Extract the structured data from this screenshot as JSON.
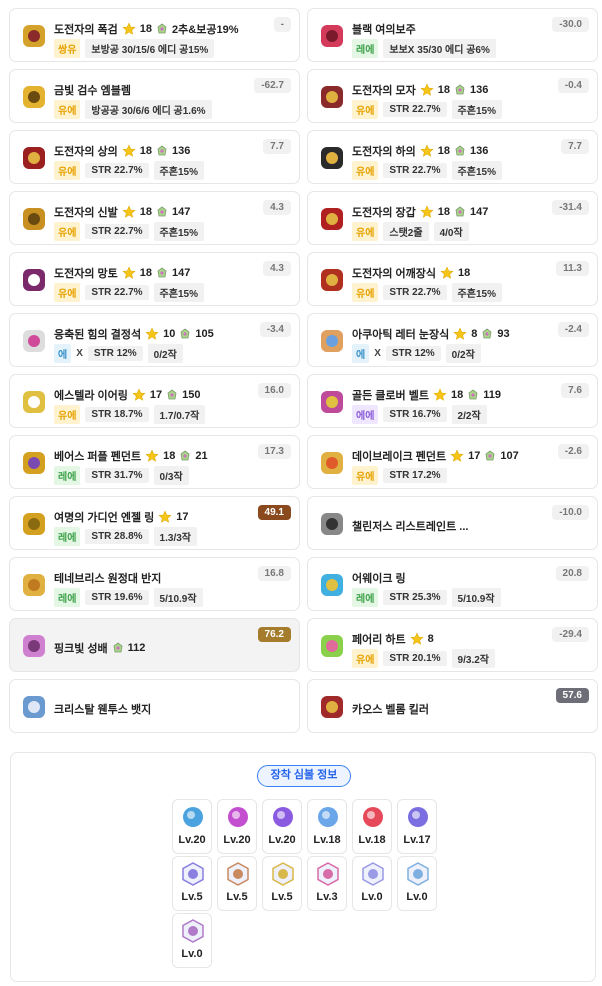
{
  "items": [
    {
      "name": "도전자의 폭검",
      "star": "18",
      "gem": "2추&보공19%",
      "tag": "쌍유",
      "tag_class": "pot-unique",
      "stats": [
        "보방공 30/15/6 에디 공15%"
      ],
      "score": "-",
      "icon": "sword-icon"
    },
    {
      "name": "블랙 여의보주",
      "star": "",
      "gem": "",
      "tag": "레에",
      "tag_class": "pot-legend",
      "stats": [
        "보보X 35/30 에디 공6%"
      ],
      "score": "-30.0",
      "icon": "orb-icon"
    },
    {
      "name": "금빛 검수 엠블렘",
      "star": "",
      "gem": "",
      "tag": "유에",
      "tag_class": "pot-unique",
      "stats": [
        "방공공 30/6/6 에디 공1.6%"
      ],
      "score": "-62.7",
      "icon": "emblem-icon"
    },
    {
      "name": "도전자의 모자",
      "star": "18",
      "gem": "136",
      "tag": "유에",
      "tag_class": "pot-unique",
      "stats": [
        "STR 22.7%",
        "주흔15%"
      ],
      "score": "-0.4",
      "icon": "hat-icon"
    },
    {
      "name": "도전자의 상의",
      "star": "18",
      "gem": "136",
      "tag": "유에",
      "tag_class": "pot-unique",
      "stats": [
        "STR 22.7%",
        "주흔15%"
      ],
      "score": "7.7",
      "icon": "top-icon"
    },
    {
      "name": "도전자의 하의",
      "star": "18",
      "gem": "136",
      "tag": "유에",
      "tag_class": "pot-unique",
      "stats": [
        "STR 22.7%",
        "주흔15%"
      ],
      "score": "7.7",
      "icon": "pants-icon"
    },
    {
      "name": "도전자의 신발",
      "star": "18",
      "gem": "147",
      "tag": "유에",
      "tag_class": "pot-unique",
      "stats": [
        "STR 22.7%",
        "주흔15%"
      ],
      "score": "4.3",
      "icon": "shoes-icon"
    },
    {
      "name": "도전자의 장갑",
      "star": "18",
      "gem": "147",
      "tag": "유에",
      "tag_class": "pot-unique",
      "stats": [
        "스탯2줄",
        "4/0작"
      ],
      "score": "-31.4",
      "icon": "glove-icon"
    },
    {
      "name": "도전자의 망토",
      "star": "18",
      "gem": "147",
      "tag": "유에",
      "tag_class": "pot-unique",
      "stats": [
        "STR 22.7%",
        "주흔15%"
      ],
      "score": "4.3",
      "icon": "cape-icon"
    },
    {
      "name": "도전자의 어깨장식",
      "star": "18",
      "gem": "",
      "tag": "유에",
      "tag_class": "pot-unique",
      "stats": [
        "STR 22.7%",
        "주흔15%"
      ],
      "score": "11.3",
      "icon": "shoulder-icon"
    },
    {
      "name": "응축된 힘의 결정석",
      "star": "10",
      "gem": "105",
      "tag": "에",
      "tag_class": "pot-rare",
      "tag2": "X",
      "stats": [
        "STR 12%",
        "0/2작"
      ],
      "score": "-3.4",
      "icon": "pocket-icon"
    },
    {
      "name": "아쿠아틱 레터 눈장식",
      "star": "8",
      "gem": "93",
      "tag": "에",
      "tag_class": "pot-rare",
      "tag2": "X",
      "stats": [
        "STR 12%",
        "0/2작"
      ],
      "score": "-2.4",
      "icon": "eye-icon"
    },
    {
      "name": "에스텔라 이어링",
      "star": "17",
      "gem": "150",
      "tag": "유에",
      "tag_class": "pot-unique",
      "stats": [
        "STR 18.7%",
        "1.7/0.7작"
      ],
      "score": "16.0",
      "icon": "earring-icon"
    },
    {
      "name": "골든 클로버 벨트",
      "star": "18",
      "gem": "119",
      "tag": "에에",
      "tag_class": "pot-epic",
      "stats": [
        "STR 16.7%",
        "2/2작"
      ],
      "score": "7.6",
      "icon": "belt-icon"
    },
    {
      "name": "베어스 퍼플 펜던트",
      "star": "18",
      "gem": "21",
      "tag": "레에",
      "tag_class": "pot-legend",
      "stats": [
        "STR 31.7%",
        "0/3작"
      ],
      "score": "17.3",
      "icon": "pendant-icon"
    },
    {
      "name": "데이브레이크 펜던트",
      "star": "17",
      "gem": "107",
      "tag": "유에",
      "tag_class": "pot-unique",
      "stats": [
        "STR 17.2%"
      ],
      "score": "-2.6",
      "icon": "pendant2-icon"
    },
    {
      "name": "여명의 가디언 엔젤 링",
      "star": "17",
      "gem": "",
      "tag": "레에",
      "tag_class": "pot-legend",
      "stats": [
        "STR 28.8%",
        "1.3/3작"
      ],
      "score": "49.1",
      "icon": "ring-icon",
      "score_class": "dark"
    },
    {
      "name": "챌린저스 리스트레인트 ...",
      "star": "",
      "gem": "",
      "tag": "",
      "tag_class": "",
      "stats": [],
      "score": "-10.0",
      "icon": "ring2-icon"
    },
    {
      "name": "테네브리스 원정대 반지",
      "star": "",
      "gem": "",
      "tag": "레에",
      "tag_class": "pot-legend",
      "stats": [
        "STR 19.6%",
        "5/10.9작"
      ],
      "score": "16.8",
      "icon": "ring3-icon"
    },
    {
      "name": "어웨이크 링",
      "star": "",
      "gem": "",
      "tag": "레에",
      "tag_class": "pot-legend",
      "stats": [
        "STR 25.3%",
        "5/10.9작"
      ],
      "score": "20.8",
      "icon": "ring4-icon"
    },
    {
      "name": "핑크빛 성배",
      "star": "",
      "gem": "112",
      "tag": "",
      "tag_class": "",
      "stats": [],
      "score": "76.2",
      "icon": "chalice-icon",
      "score_class": "gold",
      "highlight": true
    },
    {
      "name": "페어리 하트",
      "star": "8",
      "gem": "",
      "tag": "유에",
      "tag_class": "pot-unique",
      "stats": [
        "STR 20.1%",
        "9/3.2작"
      ],
      "score": "-29.4",
      "icon": "heart-icon"
    },
    {
      "name": "크리스탈 웬투스 뱃지",
      "star": "",
      "gem": "",
      "tag": "",
      "tag_class": "",
      "stats": [],
      "score": "",
      "icon": "badge-icon"
    },
    {
      "name": "카오스 벨롬 킬러",
      "star": "",
      "gem": "",
      "tag": "",
      "tag_class": "",
      "stats": [],
      "score": "57.6",
      "icon": "medal-icon",
      "score_class": "gray"
    }
  ],
  "symbols": {
    "title": "장착 심볼 정보",
    "list": [
      {
        "lv": "Lv.20",
        "color": "#4aa3df"
      },
      {
        "lv": "Lv.20",
        "color": "#c34fd0"
      },
      {
        "lv": "Lv.20",
        "color": "#8a5be0"
      },
      {
        "lv": "Lv.18",
        "color": "#6aa6e8"
      },
      {
        "lv": "Lv.18",
        "color": "#e64a5a"
      },
      {
        "lv": "Lv.17",
        "color": "#7b6ee0"
      },
      {
        "lv": "Lv.5",
        "color": "#8a7ee0"
      },
      {
        "lv": "Lv.5",
        "color": "#c98a60"
      },
      {
        "lv": "Lv.5",
        "color": "#d8b84a"
      },
      {
        "lv": "Lv.3",
        "color": "#d96ba8"
      },
      {
        "lv": "Lv.0",
        "color": "#9a9ae6"
      },
      {
        "lv": "Lv.0",
        "color": "#7fb0e0"
      },
      {
        "lv": "Lv.0",
        "color": "#b07ac8"
      }
    ]
  }
}
